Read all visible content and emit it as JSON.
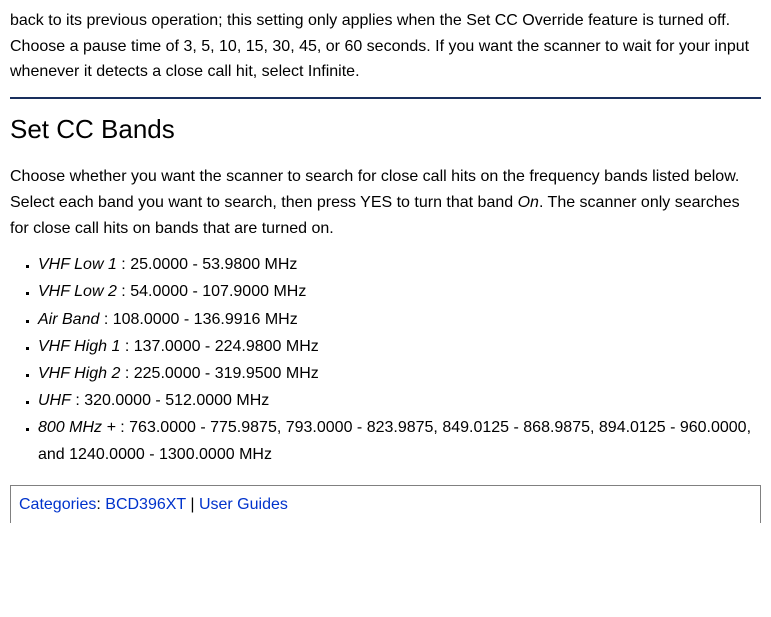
{
  "intro_paragraph": "back to its previous operation; this setting only applies when the Set CC Override feature is turned off. Choose a pause time of 3, 5, 10, 15, 30, 45, or 60 seconds. If you want the scanner to wait for your input whenever it detects a close call hit, select Infinite.",
  "heading": "Set CC Bands",
  "section_paragraph_prefix": "Choose whether you want the scanner to search for close call hits on the frequency bands listed below. Select each band you want to search, then press YES to turn that band ",
  "section_paragraph_em": "On",
  "section_paragraph_suffix": ". The scanner only searches for close call hits on bands that are turned on.",
  "bands": [
    {
      "name": "VHF Low 1",
      "range": "25.0000 - 53.9800 MHz"
    },
    {
      "name": "VHF Low 2",
      "range": "54.0000 - 107.9000 MHz"
    },
    {
      "name": "Air Band",
      "range": "108.0000 - 136.9916 MHz"
    },
    {
      "name": "VHF High 1",
      "range": "137.0000 - 224.9800 MHz"
    },
    {
      "name": "VHF High 2",
      "range": "225.0000 - 319.9500 MHz"
    },
    {
      "name": "UHF",
      "range": "320.0000 - 512.0000 MHz"
    },
    {
      "name": "800 MHz +",
      "range": "763.0000 - 775.9875, 793.0000 - 823.9875, 849.0125 - 868.9875, 894.0125 - 960.0000, and 1240.0000 - 1300.0000 MHz"
    }
  ],
  "categories": {
    "label": "Categories",
    "items": [
      "BCD396XT",
      "User Guides"
    ],
    "separator": " | "
  }
}
